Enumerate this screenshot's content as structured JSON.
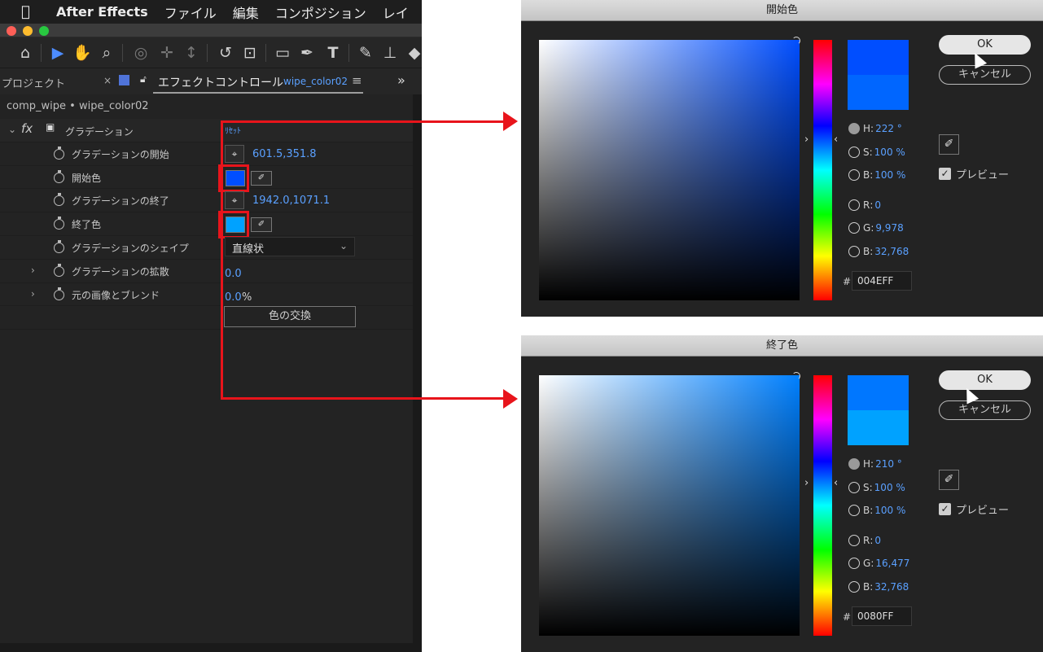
{
  "menubar": {
    "apple": "",
    "app": "After Effects",
    "items": [
      "ファイル",
      "編集",
      "コンポジション",
      "レイ"
    ]
  },
  "panel": {
    "tab_project": "プロジェクト",
    "tab_close": "×",
    "tab_effects": "エフェクトコントロール",
    "tab_layer": "wipe_color02",
    "tab_menu": "≡",
    "more": "»",
    "comp_header": "comp_wipe • wipe_color02"
  },
  "effect": {
    "fx": "fx",
    "name": "グラデーション",
    "reset": "ﾘｾｯﾄ",
    "props": {
      "start_label": "グラデーションの開始",
      "start_value": "601.5,351.8",
      "start_color_label": "開始色",
      "start_color": "#004EFF",
      "end_label": "グラデーションの終了",
      "end_value": "1942.0,1071.1",
      "end_color_label": "終了色",
      "end_color": "#0080FF",
      "end_color_swatch": "#00a2ff",
      "shape_label": "グラデーションのシェイプ",
      "shape_value": "直線状",
      "scatter_label": "グラデーションの拡散",
      "scatter_value": "0.0",
      "blend_label": "元の画像とブレンド",
      "blend_value": "0.0",
      "blend_unit": "%",
      "swap_button": "色の交換"
    }
  },
  "dialogs": [
    {
      "title": "開始色",
      "ok": "OK",
      "cancel": "キャンセル",
      "h_label": "H",
      "h_value": "222 °",
      "s_label": "S",
      "s_value": "100 %",
      "b_label": "B",
      "b_value": "100 %",
      "r_label": "R",
      "r_value": "0",
      "g_label": "G",
      "g_value": "9,978",
      "b2_label": "B",
      "b2_value": "32,768",
      "hash": "#",
      "hex": "004EFF",
      "preview": "プレビュー",
      "field_hue": "#004eff",
      "new_color": "#004eff",
      "old_color": "#0066ff"
    },
    {
      "title": "終了色",
      "ok": "OK",
      "cancel": "キャンセル",
      "h_label": "H",
      "h_value": "210 °",
      "s_label": "S",
      "s_value": "100 %",
      "b_label": "B",
      "b_value": "100 %",
      "r_label": "R",
      "r_value": "0",
      "g_label": "G",
      "g_value": "16,477",
      "b2_label": "B",
      "b2_value": "32,768",
      "hash": "#",
      "hex": "0080FF",
      "preview": "プレビュー",
      "field_hue": "#0080ff",
      "new_color": "#0077ff",
      "old_color": "#00a2ff"
    }
  ],
  "colors": {
    "highlight_red": "#e8141b",
    "value_blue": "#5aa0ff"
  }
}
